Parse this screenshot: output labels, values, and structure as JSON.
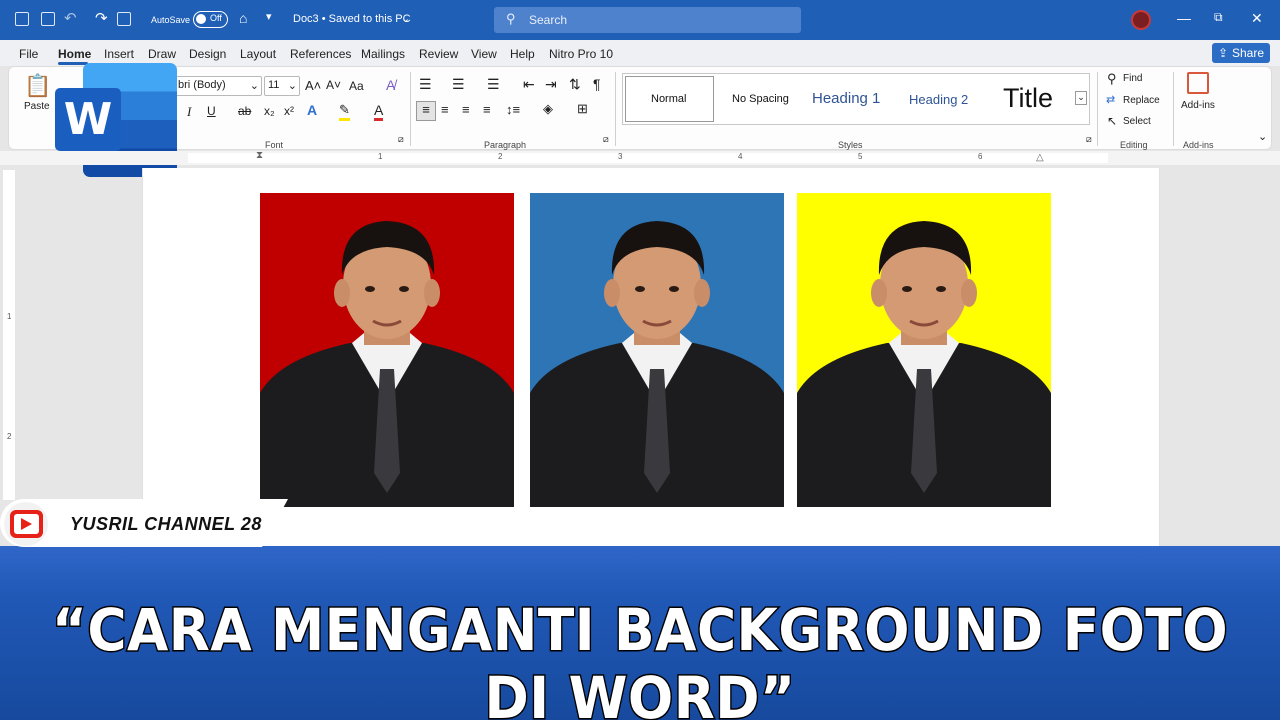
{
  "titlebar": {
    "autosave_label": "AutoSave",
    "autosave_state": "Off",
    "doc_title": "Doc3 • Saved to this PC",
    "search_placeholder": "Search"
  },
  "menu": {
    "tabs": [
      "File",
      "Home",
      "Insert",
      "Draw",
      "Design",
      "Layout",
      "References",
      "Mailings",
      "Review",
      "View",
      "Help",
      "Nitro Pro 10"
    ],
    "active": "Home",
    "share_label": "Share"
  },
  "ribbon": {
    "clipboard": {
      "paste_label": "Paste"
    },
    "font": {
      "name": "bri (Body)",
      "size": "11",
      "group_label": "Font",
      "case_label": "Aa"
    },
    "paragraph": {
      "group_label": "Paragraph"
    },
    "styles": {
      "group_label": "Styles",
      "items": [
        "Normal",
        "No Spacing",
        "Heading 1",
        "Heading 2",
        "Title"
      ]
    },
    "editing": {
      "group_label": "Editing",
      "find": "Find",
      "replace": "Replace",
      "select": "Select"
    },
    "addins": {
      "label": "Add-ins",
      "group_label": "Add-ins"
    }
  },
  "ruler": {
    "numbers": [
      "1",
      "2",
      "3",
      "4",
      "5",
      "6"
    ],
    "vertical_numbers": [
      "1",
      "2"
    ]
  },
  "document": {
    "photos": [
      {
        "background": "#c00000"
      },
      {
        "background": "#2e75b6"
      },
      {
        "background": "#ffff00"
      }
    ]
  },
  "overlay": {
    "logo_letter": "W",
    "channel_name": "YUSRIL CHANNEL 28",
    "banner_title": "“CARA MENGANTI BACKGROUND FOTO DI WORD”"
  },
  "colors": {
    "accent": "#1f5fb6",
    "banner": "#2058b6"
  }
}
